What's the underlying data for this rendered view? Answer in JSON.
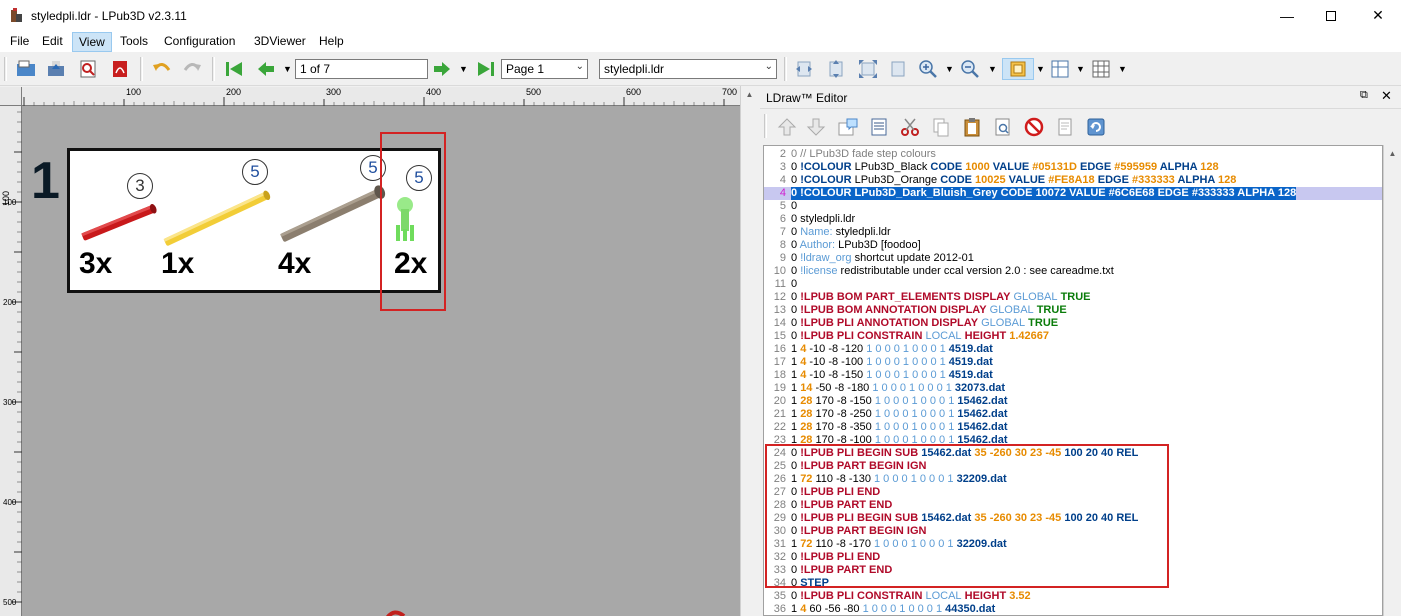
{
  "window": {
    "title": "styledpli.ldr - LPub3D v2.3.11"
  },
  "menu": [
    "File",
    "Edit",
    "View",
    "Tools",
    "Configuration",
    "3DViewer",
    "Help"
  ],
  "toolbar": {
    "page_field": "1 of 7",
    "page_combo": "Page 1",
    "model_combo": "styledpli.ldr"
  },
  "ruler": {
    "h_labels": [
      "100",
      "200",
      "300",
      "400",
      "500",
      "600",
      "700"
    ],
    "v_labels": [
      "100",
      "200",
      "300",
      "400",
      "500"
    ]
  },
  "canvas": {
    "step_number": "1",
    "parts": [
      {
        "qty": "3x",
        "annotation": "3",
        "color": "#c8191b"
      },
      {
        "qty": "1x",
        "annotation": "5",
        "color": "#f2cd37"
      },
      {
        "qty": "4x",
        "annotation": "5",
        "color": "#8b7e6e"
      },
      {
        "qty": "2x",
        "annotation": "5",
        "color": "#6fdc5c"
      }
    ]
  },
  "editor": {
    "title": "LDraw™ Editor",
    "lines": [
      {
        "n": "2",
        "segs": [
          [
            "0 // LPub3D fade step colours",
            "kw-gray"
          ]
        ]
      },
      {
        "n": "3",
        "segs": [
          [
            "0 ",
            ""
          ],
          [
            "!COLOUR",
            "kw-blue"
          ],
          [
            " LPub3D_Black ",
            ""
          ],
          [
            "CODE",
            "kw-blue"
          ],
          [
            " 1000 ",
            "kw-orange"
          ],
          [
            "VALUE",
            "kw-blue"
          ],
          [
            " #05131D ",
            "kw-orange"
          ],
          [
            "EDGE",
            "kw-blue"
          ],
          [
            " #595959 ",
            "kw-orange"
          ],
          [
            "ALPHA",
            "kw-blue"
          ],
          [
            " 128",
            "kw-orange"
          ]
        ]
      },
      {
        "n": "4",
        "segs": [
          [
            "0 ",
            ""
          ],
          [
            "!COLOUR",
            "kw-blue"
          ],
          [
            " LPub3D_Orange ",
            ""
          ],
          [
            "CODE",
            "kw-blue"
          ],
          [
            " 10025 ",
            "kw-orange"
          ],
          [
            "VALUE",
            "kw-blue"
          ],
          [
            " #FE8A18 ",
            "kw-orange"
          ],
          [
            "EDGE",
            "kw-blue"
          ],
          [
            " #333333 ",
            "kw-orange"
          ],
          [
            "ALPHA",
            "kw-blue"
          ],
          [
            " 128",
            "kw-orange"
          ]
        ]
      },
      {
        "n": "4",
        "selected": true,
        "segs": [
          [
            "0 !COLOUR LPub3D_Dark_Bluish_Grey CODE 10072 VALUE #6C6E68 EDGE #333333 ALPHA 128",
            ""
          ]
        ]
      },
      {
        "n": "5",
        "segs": [
          [
            "0",
            ""
          ]
        ]
      },
      {
        "n": "6",
        "segs": [
          [
            "0 styledpli.ldr",
            ""
          ]
        ]
      },
      {
        "n": "7",
        "segs": [
          [
            "0 ",
            ""
          ],
          [
            "Name:",
            "kw-lblue"
          ],
          [
            " styledpli.ldr",
            ""
          ]
        ]
      },
      {
        "n": "8",
        "segs": [
          [
            "0 ",
            ""
          ],
          [
            "Author:",
            "kw-lblue"
          ],
          [
            " LPub3D [foodoo]",
            ""
          ]
        ]
      },
      {
        "n": "9",
        "segs": [
          [
            "0 ",
            ""
          ],
          [
            "!ldraw_org",
            "kw-lblue"
          ],
          [
            " shortcut update 2012-01",
            ""
          ]
        ]
      },
      {
        "n": "10",
        "segs": [
          [
            "0 ",
            ""
          ],
          [
            "!license",
            "kw-lblue"
          ],
          [
            " redistributable under ccal version 2.0 : see careadme.txt",
            ""
          ]
        ]
      },
      {
        "n": "11",
        "segs": [
          [
            "0",
            ""
          ]
        ]
      },
      {
        "n": "12",
        "segs": [
          [
            "0 ",
            ""
          ],
          [
            "!LPUB BOM PART_ELEMENTS DISPLAY",
            "kw-red"
          ],
          [
            " GLOBAL",
            "kw-lblue"
          ],
          [
            " TRUE",
            "kw-green"
          ]
        ]
      },
      {
        "n": "13",
        "segs": [
          [
            "0 ",
            ""
          ],
          [
            "!LPUB BOM ANNOTATION DISPLAY",
            "kw-red"
          ],
          [
            " GLOBAL",
            "kw-lblue"
          ],
          [
            " TRUE",
            "kw-green"
          ]
        ]
      },
      {
        "n": "14",
        "segs": [
          [
            "0 ",
            ""
          ],
          [
            "!LPUB PLI ANNOTATION DISPLAY",
            "kw-red"
          ],
          [
            " GLOBAL",
            "kw-lblue"
          ],
          [
            " TRUE",
            "kw-green"
          ]
        ]
      },
      {
        "n": "15",
        "segs": [
          [
            "0 ",
            ""
          ],
          [
            "!LPUB PLI CONSTRAIN",
            "kw-red"
          ],
          [
            " LOCAL",
            "kw-lblue"
          ],
          [
            " HEIGHT",
            "kw-red"
          ],
          [
            " 1.42667",
            "kw-orange"
          ]
        ]
      },
      {
        "n": "16",
        "segs": [
          [
            "1 ",
            ""
          ],
          [
            "4",
            "kw-orange"
          ],
          [
            " -10 -8 -120 ",
            ""
          ],
          [
            "1 0 0 0 1 0 0 0 1",
            "kw-lblue"
          ],
          [
            " 4519.dat",
            "kw-blue"
          ]
        ]
      },
      {
        "n": "17",
        "segs": [
          [
            "1 ",
            ""
          ],
          [
            "4",
            "kw-orange"
          ],
          [
            " -10 -8 -100 ",
            ""
          ],
          [
            "1 0 0 0 1 0 0 0 1",
            "kw-lblue"
          ],
          [
            " 4519.dat",
            "kw-blue"
          ]
        ]
      },
      {
        "n": "18",
        "segs": [
          [
            "1 ",
            ""
          ],
          [
            "4",
            "kw-orange"
          ],
          [
            " -10 -8 -150 ",
            ""
          ],
          [
            "1 0 0 0 1 0 0 0 1",
            "kw-lblue"
          ],
          [
            " 4519.dat",
            "kw-blue"
          ]
        ]
      },
      {
        "n": "19",
        "segs": [
          [
            "1 ",
            ""
          ],
          [
            "14",
            "kw-orange"
          ],
          [
            " -50 -8 -180 ",
            ""
          ],
          [
            "1 0 0 0 1 0 0 0 1",
            "kw-lblue"
          ],
          [
            " 32073.dat",
            "kw-blue"
          ]
        ]
      },
      {
        "n": "20",
        "segs": [
          [
            "1 ",
            ""
          ],
          [
            "28",
            "kw-orange"
          ],
          [
            " 170 -8 -150 ",
            ""
          ],
          [
            "1 0 0 0 1 0 0 0 1",
            "kw-lblue"
          ],
          [
            " 15462.dat",
            "kw-blue"
          ]
        ]
      },
      {
        "n": "21",
        "segs": [
          [
            "1 ",
            ""
          ],
          [
            "28",
            "kw-orange"
          ],
          [
            " 170 -8 -250 ",
            ""
          ],
          [
            "1 0 0 0 1 0 0 0 1",
            "kw-lblue"
          ],
          [
            " 15462.dat",
            "kw-blue"
          ]
        ]
      },
      {
        "n": "22",
        "segs": [
          [
            "1 ",
            ""
          ],
          [
            "28",
            "kw-orange"
          ],
          [
            " 170 -8 -350 ",
            ""
          ],
          [
            "1 0 0 0 1 0 0 0 1",
            "kw-lblue"
          ],
          [
            " 15462.dat",
            "kw-blue"
          ]
        ]
      },
      {
        "n": "23",
        "segs": [
          [
            "1 ",
            ""
          ],
          [
            "28",
            "kw-orange"
          ],
          [
            " 170 -8 -100 ",
            ""
          ],
          [
            "1 0 0 0 1 0 0 0 1",
            "kw-lblue"
          ],
          [
            " 15462.dat",
            "kw-blue"
          ]
        ]
      },
      {
        "n": "24",
        "segs": [
          [
            "0 ",
            ""
          ],
          [
            "!LPUB PLI BEGIN SUB",
            "kw-red"
          ],
          [
            " 15462.dat",
            "kw-blue"
          ],
          [
            " 35",
            "kw-orange"
          ],
          [
            " -260 30 23 -45",
            "kw-orange"
          ],
          [
            " 100 20 40 REL",
            "kw-blue"
          ]
        ]
      },
      {
        "n": "25",
        "segs": [
          [
            "0 ",
            ""
          ],
          [
            "!LPUB PART BEGIN IGN",
            "kw-red"
          ]
        ]
      },
      {
        "n": "26",
        "segs": [
          [
            "1 ",
            ""
          ],
          [
            "72",
            "kw-orange"
          ],
          [
            " 110 -8 -130 ",
            ""
          ],
          [
            "1 0 0 0 1 0 0 0 1",
            "kw-lblue"
          ],
          [
            " 32209.dat",
            "kw-blue"
          ]
        ]
      },
      {
        "n": "27",
        "segs": [
          [
            "0 ",
            ""
          ],
          [
            "!LPUB PLI END",
            "kw-red"
          ]
        ]
      },
      {
        "n": "28",
        "segs": [
          [
            "0 ",
            ""
          ],
          [
            "!LPUB PART END",
            "kw-red"
          ]
        ]
      },
      {
        "n": "29",
        "segs": [
          [
            "0 ",
            ""
          ],
          [
            "!LPUB PLI BEGIN SUB",
            "kw-red"
          ],
          [
            " 15462.dat",
            "kw-blue"
          ],
          [
            " 35",
            "kw-orange"
          ],
          [
            " -260 30 23 -45",
            "kw-orange"
          ],
          [
            " 100 20 40 REL",
            "kw-blue"
          ]
        ]
      },
      {
        "n": "30",
        "segs": [
          [
            "0 ",
            ""
          ],
          [
            "!LPUB PART BEGIN IGN",
            "kw-red"
          ]
        ]
      },
      {
        "n": "31",
        "segs": [
          [
            "1 ",
            ""
          ],
          [
            "72",
            "kw-orange"
          ],
          [
            " 110 -8 -170 ",
            ""
          ],
          [
            "1 0 0 0 1 0 0 0 1",
            "kw-lblue"
          ],
          [
            " 32209.dat",
            "kw-blue"
          ]
        ]
      },
      {
        "n": "32",
        "segs": [
          [
            "0 ",
            ""
          ],
          [
            "!LPUB PLI END",
            "kw-red"
          ]
        ]
      },
      {
        "n": "33",
        "segs": [
          [
            "0 ",
            ""
          ],
          [
            "!LPUB PART END",
            "kw-red"
          ]
        ]
      },
      {
        "n": "34",
        "segs": [
          [
            "0 ",
            ""
          ],
          [
            "STEP",
            "kw-blue"
          ]
        ]
      },
      {
        "n": "35",
        "segs": [
          [
            "0 ",
            ""
          ],
          [
            "!LPUB PLI CONSTRAIN",
            "kw-red"
          ],
          [
            " LOCAL",
            "kw-lblue"
          ],
          [
            " HEIGHT",
            "kw-red"
          ],
          [
            " 3.52",
            "kw-orange"
          ]
        ]
      },
      {
        "n": "36",
        "segs": [
          [
            "1 ",
            ""
          ],
          [
            "4",
            "kw-orange"
          ],
          [
            " 60 -56 -80 ",
            ""
          ],
          [
            "1 0 0 0 1 0 0 0 1",
            "kw-lblue"
          ],
          [
            " 44350.dat",
            "kw-blue"
          ]
        ]
      }
    ]
  }
}
